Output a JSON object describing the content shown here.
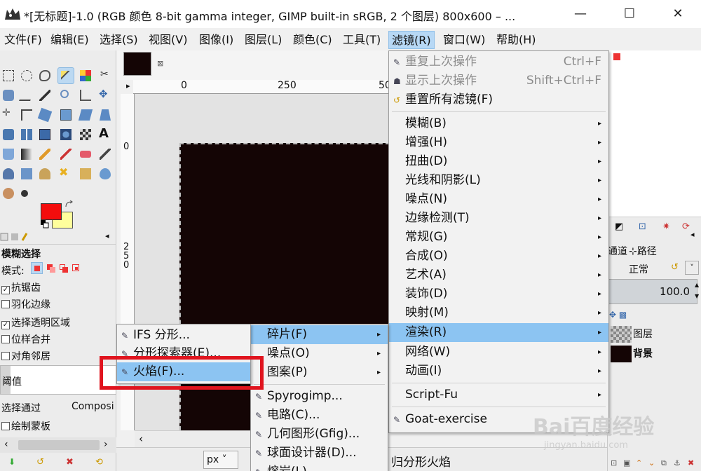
{
  "window": {
    "title": "*[无标题]-1.0 (RGB 颜色 8-bit gamma integer, GIMP built-in sRGB, 2 个图层) 800x600 – ...",
    "minimize": "—",
    "maximize": "☐",
    "close": "✕"
  },
  "menubar": [
    {
      "label": "文件(F)"
    },
    {
      "label": "编辑(E)"
    },
    {
      "label": "选择(S)"
    },
    {
      "label": "视图(V)"
    },
    {
      "label": "图像(I)"
    },
    {
      "label": "图层(L)"
    },
    {
      "label": "颜色(C)"
    },
    {
      "label": "工具(T)"
    },
    {
      "label": "滤镜(R)"
    },
    {
      "label": "窗口(W)"
    },
    {
      "label": "帮助(H)"
    }
  ],
  "colors": {
    "foreground": "#f40d0d",
    "background": "#fefe9c",
    "canvas": "#140505",
    "highlight": "#8cc4f2",
    "annotation": "#e0141e"
  },
  "tool_options": {
    "title": "模糊选择",
    "mode_label": "模式:",
    "antialias": "抗锯齿",
    "feather": "羽化边缘",
    "select_transparent": "选择透明区域",
    "sample_merged": "位样合并",
    "diagonal": "对角邻居",
    "threshold": "阈值",
    "select_by_label": "选择通过",
    "select_by_value": "Composi",
    "draw_mask": "绘制蒙板"
  },
  "rulers": {
    "top": [
      "0",
      "250",
      "50"
    ],
    "left_0": "0",
    "left_250": "2\n5\n0"
  },
  "statusbar": {
    "unit": "px",
    "message": "归分形火焰"
  },
  "right_dock": {
    "tab_channels": "通道",
    "tab_paths": "路径",
    "mode": "正常",
    "opacity": "100.0",
    "layers": [
      {
        "name": "图层"
      },
      {
        "name": "背景"
      }
    ]
  },
  "filters_menu": [
    {
      "label": "重复上次操作",
      "shortcut": "Ctrl+F",
      "disabled": true
    },
    {
      "label": "显示上次操作",
      "shortcut": "Shift+Ctrl+F",
      "disabled": true
    },
    {
      "label": "重置所有滤镜(F)",
      "shortcut": "",
      "disabled": false
    },
    {
      "label": "模糊(B)"
    },
    {
      "label": "增强(H)"
    },
    {
      "label": "扭曲(D)"
    },
    {
      "label": "光线和阴影(L)"
    },
    {
      "label": "噪点(N)"
    },
    {
      "label": "边缘检测(T)"
    },
    {
      "label": "常规(G)"
    },
    {
      "label": "合成(O)"
    },
    {
      "label": "艺术(A)"
    },
    {
      "label": "装饰(D)"
    },
    {
      "label": "映射(M)"
    },
    {
      "label": "渲染(R)"
    },
    {
      "label": "网络(W)"
    },
    {
      "label": "动画(I)"
    },
    {
      "label": "Script-Fu"
    },
    {
      "label": "Goat-exercise"
    }
  ],
  "render_submenu": [
    {
      "label": "碎片(F)"
    },
    {
      "label": "噪点(O)"
    },
    {
      "label": "图案(P)"
    },
    {
      "label": "Spyrogimp..."
    },
    {
      "label": "电路(C)..."
    },
    {
      "label": "几何图形(Gfig)..."
    },
    {
      "label": "球面设计器(D)..."
    },
    {
      "label": "熔岩(L)..."
    }
  ],
  "fractal_submenu": [
    {
      "label": "IFS 分形..."
    },
    {
      "label": "分形探索器(E)..."
    },
    {
      "label": "火焰(F)..."
    }
  ],
  "watermark": {
    "text": "Bai百度经验",
    "sub": "jingyan.baidu.com"
  }
}
